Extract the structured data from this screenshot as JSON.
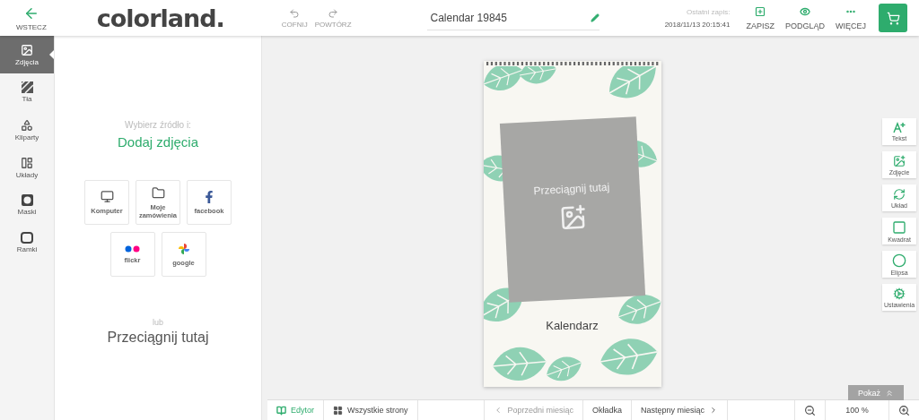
{
  "header": {
    "back": {
      "label": "WSTECZ"
    },
    "logo": "colorland.",
    "undo": {
      "label": "COFNIJ",
      "disabled": true
    },
    "redo": {
      "label": "POWTÓRZ",
      "disabled": true
    },
    "title": {
      "value": "Calendar 19845"
    },
    "last_save": {
      "label": "Ostatni zapis:",
      "value": "2018/11/13 20:15:41"
    },
    "actions": [
      {
        "kind": "save",
        "label": "ZAPISZ"
      },
      {
        "kind": "preview",
        "label": "PODGLĄD"
      },
      {
        "kind": "more",
        "label": "WIĘCEJ"
      }
    ]
  },
  "rail": [
    {
      "kind": "photos",
      "label": "Zdjęcia",
      "selected": true
    },
    {
      "kind": "backgrounds",
      "label": "Tła",
      "selected": false
    },
    {
      "kind": "cliparts",
      "label": "Kliparty",
      "selected": false
    },
    {
      "kind": "layouts",
      "label": "Układy",
      "selected": false
    },
    {
      "kind": "masks",
      "label": "Maski",
      "selected": false
    },
    {
      "kind": "frames",
      "label": "Ramki",
      "selected": false
    }
  ],
  "panel": {
    "subtitle": "Wybierz źródło i:",
    "heading": "Dodaj zdjęcia",
    "sources": [
      {
        "kind": "computer",
        "label": "Komputer"
      },
      {
        "kind": "orders",
        "label": "Moje zamówienia"
      },
      {
        "kind": "facebook",
        "label": "facebook"
      },
      {
        "kind": "flickr",
        "label": "flickr"
      },
      {
        "kind": "google",
        "label": "google"
      }
    ],
    "or": "lub",
    "drop": "Przeciągnij tutaj"
  },
  "calendar": {
    "photo_hint": "Przeciągnij tutaj",
    "title": "Kalendarz"
  },
  "tools": [
    {
      "kind": "text",
      "label": "Tekst"
    },
    {
      "kind": "photo",
      "label": "Zdjęcie"
    },
    {
      "kind": "layout",
      "label": "Układ"
    },
    {
      "kind": "square",
      "label": "Kwadrat"
    },
    {
      "kind": "ellipse",
      "label": "Elipsa"
    },
    {
      "kind": "settings",
      "label": "Ustawienia"
    }
  ],
  "bottom": {
    "views": [
      {
        "kind": "editor",
        "label": "Edytor",
        "selected": true
      },
      {
        "kind": "all",
        "label": "Wszystkie strony",
        "selected": false
      }
    ],
    "prev": {
      "label": "Poprzedni miesiąc",
      "disabled": true
    },
    "cover": "Okładka",
    "next": {
      "label": "Następny miesiąc",
      "disabled": false
    },
    "zoom": "100 %",
    "show": "Pokaż"
  }
}
